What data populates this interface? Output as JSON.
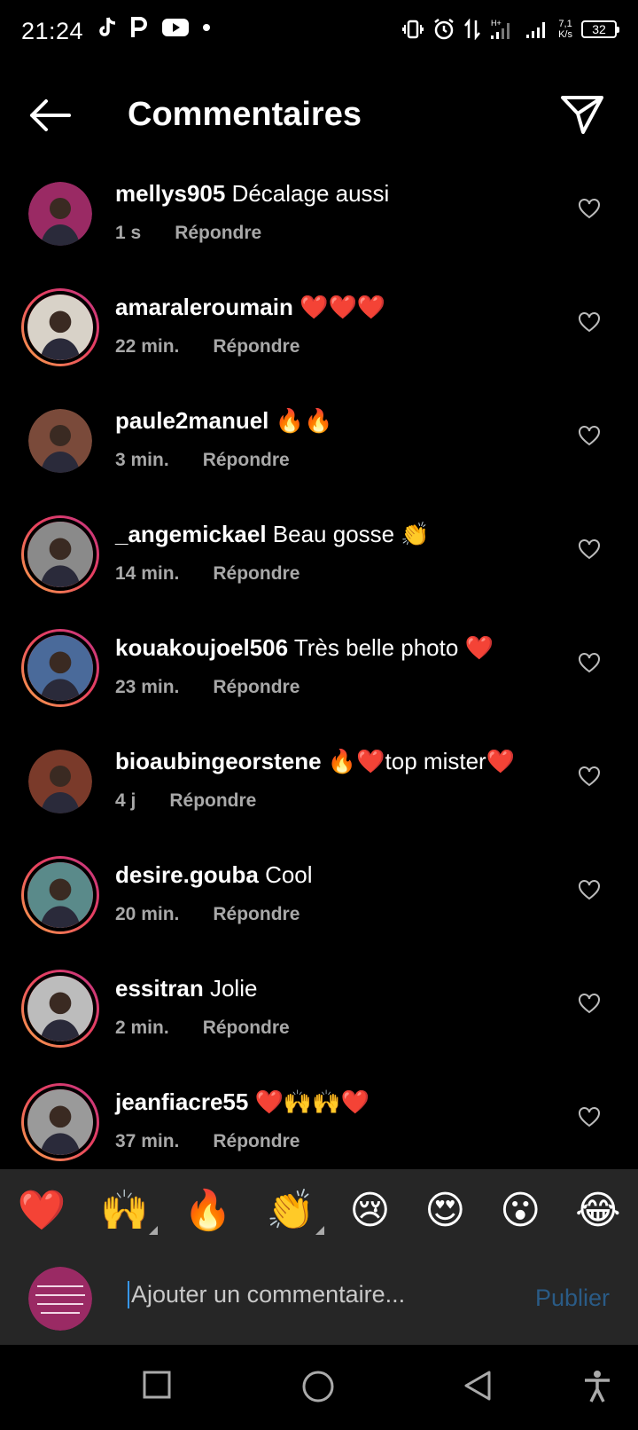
{
  "status_bar": {
    "time": "21:24",
    "left_icons": [
      "tiktok-icon",
      "p-icon",
      "youtube-icon",
      "dot-icon"
    ],
    "speed_top": "7,1",
    "speed_bottom": "K/s",
    "battery": "32"
  },
  "header": {
    "title": "Commentaires"
  },
  "comments": [
    {
      "username": "mellys905",
      "text": "Décalage aussi",
      "time": "1 s",
      "reply": "Répondre",
      "story_ring": false,
      "avatar_color": "#9a2a64"
    },
    {
      "username": "amaraleroumain",
      "text": "❤️❤️❤️",
      "time": "22 min.",
      "reply": "Répondre",
      "story_ring": true,
      "avatar_color": "#d8d2c8"
    },
    {
      "username": "paule2manuel",
      "text": "🔥🔥",
      "time": "3 min.",
      "reply": "Répondre",
      "story_ring": false,
      "avatar_color": "#7a4a3a"
    },
    {
      "username": "_angemickael",
      "text": "Beau gosse 👏",
      "time": "14 min.",
      "reply": "Répondre",
      "story_ring": true,
      "avatar_color": "#8a8a8a"
    },
    {
      "username": "kouakoujoel506",
      "text": "Très belle photo ❤️",
      "time": "23 min.",
      "reply": "Répondre",
      "story_ring": true,
      "avatar_color": "#4a6a9a"
    },
    {
      "username": "bioaubingeorstene",
      "text": "🔥❤️top mister❤️",
      "time": "4 j",
      "reply": "Répondre",
      "story_ring": false,
      "avatar_color": "#7a3a2a"
    },
    {
      "username": "desire.gouba",
      "text": "Cool",
      "time": "20 min.",
      "reply": "Répondre",
      "story_ring": true,
      "avatar_color": "#5a8a8a"
    },
    {
      "username": "essitran",
      "text": "Jolie",
      "time": "2 min.",
      "reply": "Répondre",
      "story_ring": true,
      "avatar_color": "#bcbcbc"
    },
    {
      "username": "jeanfiacre55",
      "text": "❤️🙌🙌❤️",
      "time": "37 min.",
      "reply": "Répondre",
      "story_ring": true,
      "avatar_color": "#9a9a9a"
    }
  ],
  "emoji_bar": [
    "❤️",
    "🙌",
    "🔥",
    "👏",
    "😢",
    "😍",
    "😮",
    "😂"
  ],
  "composer": {
    "placeholder": "Ajouter un commentaire...",
    "publish": "Publier"
  }
}
